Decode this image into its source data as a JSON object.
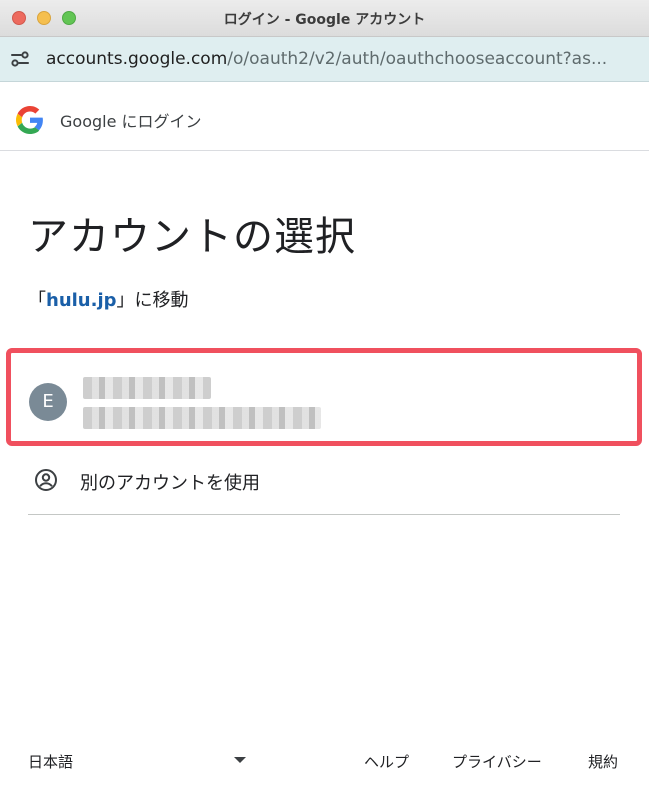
{
  "window": {
    "title": "ログイン - Google アカウント"
  },
  "address_bar": {
    "host": "accounts.google.com",
    "path": "/o/oauth2/v2/auth/oauthchooseaccount?as..."
  },
  "header": {
    "text": "Google にログイン"
  },
  "main": {
    "title": "アカウントの選択",
    "continue_prefix": "「",
    "continue_link": "hulu.jp",
    "continue_suffix": "」に移動",
    "account": {
      "avatar_initial": "E",
      "highlight_color": "#f0505e"
    },
    "other_account_label": "別のアカウントを使用"
  },
  "footer": {
    "language": "日本語",
    "help": "ヘルプ",
    "privacy": "プライバシー",
    "terms": "規約"
  },
  "colors": {
    "link": "#1a5fa8",
    "avatar_bg": "#7a8a96",
    "url_bar_bg": "#dfeef0"
  }
}
